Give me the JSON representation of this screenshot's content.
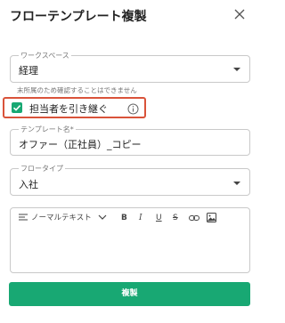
{
  "dialog": {
    "title": "フローテンプレート複製",
    "close_icon": "close-icon"
  },
  "workspace": {
    "label": "ワークスペース",
    "value": "経理",
    "helper": "末所属のため確認することはできません"
  },
  "inherit": {
    "label": "担当者を引き継ぐ",
    "checked": true,
    "check_color": "#18a873",
    "highlight_color": "#d9533a"
  },
  "template_name": {
    "label": "テンプレート名*",
    "value": "オファー（正社員）_コピー"
  },
  "flow_type": {
    "label": "フロータイプ",
    "value": "入社"
  },
  "editor": {
    "paragraph_style": "ノーマルテキスト",
    "bold": "B",
    "italic": "I",
    "underline": "U",
    "strike": "S"
  },
  "submit": {
    "label": "複製",
    "color": "#18a873"
  }
}
